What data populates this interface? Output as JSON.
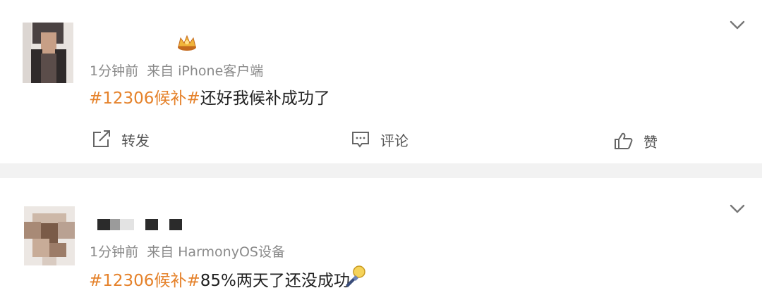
{
  "feed": [
    {
      "meta_time": "1分钟前",
      "meta_source": "来自 iPhone客户端",
      "hashtag": "#12306候补#",
      "body": "还好我候补成功了",
      "actions": {
        "repost": "转发",
        "comment": "评论",
        "like": "赞"
      }
    },
    {
      "meta_time": "1分钟前",
      "meta_source": "来自 HarmonyOS设备",
      "hashtag": "#12306候补#",
      "body": "85%两天了还没成功"
    }
  ],
  "colors": {
    "hashtag": "#e5822b",
    "meta": "#8a8a8a",
    "divider": "#f2f2f2"
  },
  "icons": [
    "chevron-down-icon",
    "repost-icon",
    "comment-icon",
    "like-icon",
    "crown-icon",
    "rocket-icon"
  ]
}
